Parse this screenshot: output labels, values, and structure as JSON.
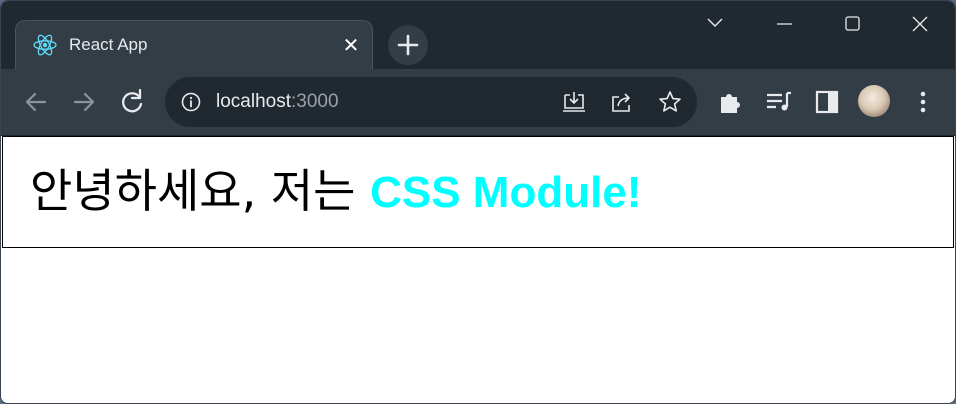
{
  "tab": {
    "title": "React App",
    "favicon": "react-logo-icon",
    "close_symbol": "✕"
  },
  "new_tab_icon": "plus-icon",
  "window_controls": [
    "chevron-down-icon",
    "minimize-icon",
    "maximize-icon",
    "close-icon"
  ],
  "toolbar": {
    "back_icon": "back-arrow-icon",
    "forward_icon": "forward-arrow-icon",
    "reload_icon": "reload-icon",
    "omnibox": {
      "info_icon": "info-icon",
      "host": "localhost",
      "port": ":3000",
      "install_icon": "install-app-icon",
      "share_icon": "share-icon",
      "bookmark_icon": "star-icon"
    },
    "extensions_icon": "puzzle-icon",
    "media_icon": "media-queue-icon",
    "side_panel_icon": "side-panel-icon",
    "profile": "profile-avatar",
    "menu_icon": "kebab-menu-icon"
  },
  "page": {
    "greeting": "안녕하세요, 저는 ",
    "highlight": "CSS Module!",
    "highlight_color": "#00ffff"
  },
  "colors": {
    "tabstrip": "#202830",
    "toolbar": "#333d45",
    "omnibox": "#202830",
    "icon": "#e8eaed"
  }
}
